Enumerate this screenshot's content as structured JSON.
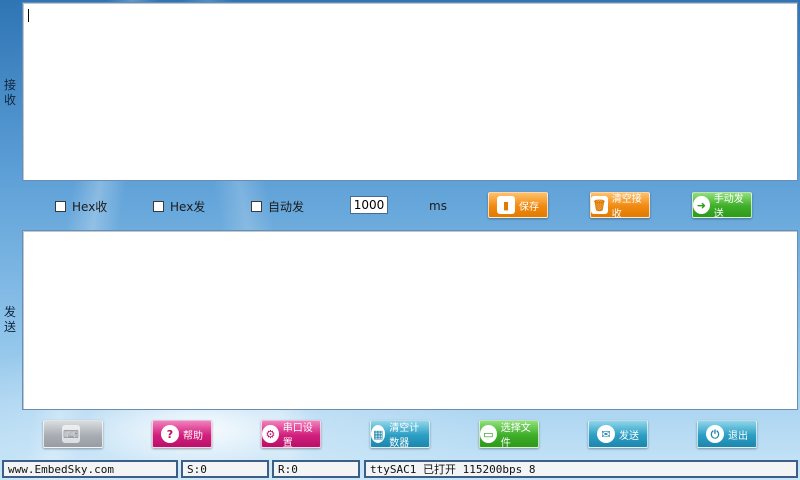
{
  "receive": {
    "label_line1": "接",
    "label_line2": "收"
  },
  "send": {
    "label_line1": "发",
    "label_line2": "送"
  },
  "options": {
    "hex_recv": {
      "label": "Hex收",
      "checked": false
    },
    "hex_send": {
      "label": "Hex发",
      "checked": false
    },
    "auto_send": {
      "label": "自动发",
      "checked": false
    },
    "interval_value": "1000",
    "interval_unit": "ms"
  },
  "top_buttons": {
    "save": {
      "icon": "save-icon",
      "label": "保存"
    },
    "clear_receive": {
      "icon": "trash-icon",
      "label": "清空接收"
    },
    "manual_send": {
      "icon": "send-arrow-icon",
      "label": "手动发送"
    }
  },
  "bottom_buttons": {
    "keyboard": {
      "icon": "keyboard-icon",
      "label": ""
    },
    "help": {
      "icon": "help-icon",
      "label": "帮助"
    },
    "serial_settings": {
      "icon": "serial-settings-icon",
      "label": "串口设置"
    },
    "clear_counter": {
      "icon": "calculator-icon",
      "label": "清空计数器"
    },
    "select_file": {
      "icon": "folder-icon",
      "label": "选择文件"
    },
    "send": {
      "icon": "envelope-icon",
      "label": "发送"
    },
    "exit": {
      "icon": "power-icon",
      "label": "退出"
    }
  },
  "status_bar": {
    "website": "www.EmbedSky.com",
    "sent_count": "S:0",
    "recv_count": "R:0",
    "port_info": "ttySAC1  已打开  115200bps 8"
  },
  "colors": {
    "orange": "#f08a12",
    "green": "#3fae2a",
    "magenta": "#d1207e",
    "teal": "#2c9ec4",
    "gray": "#a8aeb3",
    "status_border": "#3b5f86"
  }
}
